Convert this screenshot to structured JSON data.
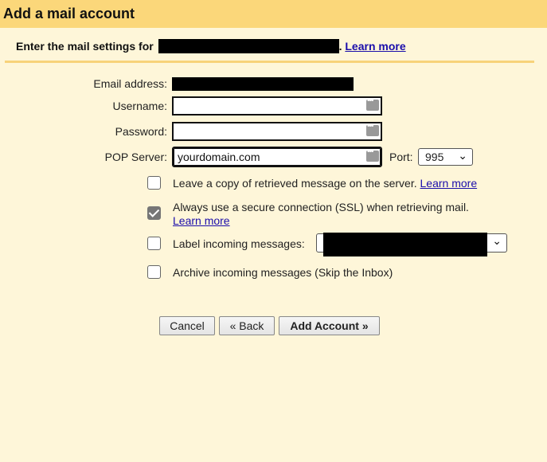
{
  "dialog": {
    "title": "Add a mail account",
    "instruction": "Enter the mail settings for",
    "instruction_suffix": ".",
    "learn_more": "Learn more"
  },
  "form": {
    "email_label": "Email address:",
    "username_label": "Username:",
    "password_label": "Password:",
    "pop_label": "POP Server:",
    "pop_value": "yourdomain.com",
    "port_label": "Port:",
    "port_value": "995"
  },
  "options": {
    "leave_copy": {
      "label": "Leave a copy of retrieved message on the server.",
      "link": "Learn more",
      "checked": false
    },
    "ssl": {
      "label": "Always use a secure connection (SSL) when retrieving mail.",
      "link": "Learn more",
      "checked": true
    },
    "label_incoming": {
      "label": "Label incoming messages:",
      "checked": false
    },
    "archive": {
      "label": "Archive incoming messages (Skip the Inbox)",
      "checked": false
    }
  },
  "buttons": {
    "cancel": "Cancel",
    "back": "« Back",
    "add": "Add Account »"
  },
  "colors": {
    "background": "#fef6d9",
    "titlebar": "#fbd77a",
    "link": "#1a0dab"
  }
}
